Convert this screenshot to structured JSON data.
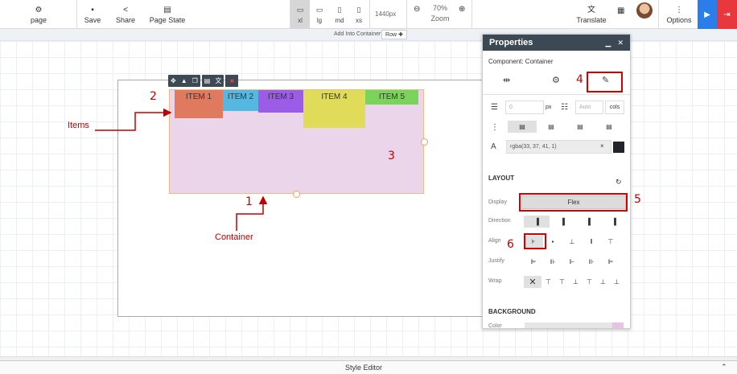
{
  "toolbar": {
    "page_label": "page",
    "save_label": "Save",
    "share_label": "Share",
    "page_state_label": "Page State",
    "devices": [
      "xl",
      "lg",
      "md",
      "xs"
    ],
    "active_device": "xl",
    "width_readout": "1440px",
    "zoom_value": "70%",
    "zoom_label": "Zoom",
    "translate_label": "Translate",
    "options_label": "Options"
  },
  "strip": {
    "add_into_label": "Add Into Container",
    "row_label": "Row"
  },
  "canvas": {
    "items": [
      {
        "label": "ITEM 1",
        "color": "#e07a5f"
      },
      {
        "label": "ITEM 2",
        "color": "#56b8e0"
      },
      {
        "label": "ITEM 3",
        "color": "#9b5de5"
      },
      {
        "label": "ITEM 4",
        "color": "#e0dc5a"
      },
      {
        "label": "ITEM 5",
        "color": "#7bd35a"
      }
    ],
    "container_color": "#ead5ea"
  },
  "annotations": {
    "n1": "1",
    "n2": "2",
    "n3": "3",
    "n4": "4",
    "n5": "5",
    "n6": "6",
    "items_label": "Items",
    "container_label": "Container",
    "color": "#c00000"
  },
  "props": {
    "title": "Properties",
    "component_label": "Component: Container",
    "width_placeholder": "0",
    "width_unit": "px",
    "cols_placeholder": "Auto",
    "cols_label": "cols",
    "color_value": "rgba(33, 37, 41, 1)",
    "color_clear": "×",
    "swatch_color": "#212529",
    "layout_section": "LAYOUT",
    "display_label": "Display",
    "display_value": "Flex",
    "direction_label": "Direction",
    "align_label": "Align",
    "justify_label": "Justify",
    "wrap_label": "Wrap",
    "background_section": "BACKGROUND",
    "bg_color_label": "Color",
    "header_color": "#3c4954"
  },
  "bottom": {
    "style_editor_label": "Style Editor"
  }
}
